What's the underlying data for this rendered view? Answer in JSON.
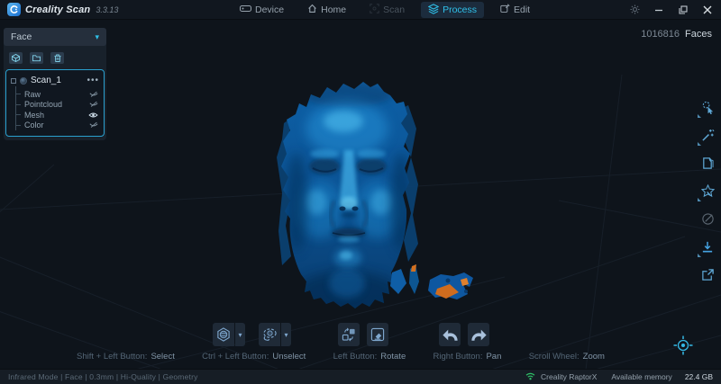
{
  "app": {
    "name": "Creality Scan",
    "version": "3.3.13"
  },
  "titlebar": {
    "tabs": [
      {
        "label": "Device",
        "state": "normal"
      },
      {
        "label": "Home",
        "state": "normal"
      },
      {
        "label": "Scan",
        "state": "disabled"
      },
      {
        "label": "Process",
        "state": "active"
      },
      {
        "label": "Edit",
        "state": "normal"
      }
    ],
    "window_controls": [
      "settings",
      "minimize",
      "maximize",
      "close"
    ]
  },
  "viewport": {
    "faces_count": "1016816",
    "faces_label": "Faces",
    "model": "blue 3D scanned human face mesh with orange debris fragments"
  },
  "left_panel": {
    "group_selector": "Face",
    "tools": [
      "import-model",
      "open-folder",
      "delete-model"
    ],
    "tree": {
      "root_label": "Scan_1",
      "items": [
        {
          "label": "Raw",
          "visible": false
        },
        {
          "label": "Pointcloud",
          "visible": false
        },
        {
          "label": "Mesh",
          "visible": true
        },
        {
          "label": "Color",
          "visible": false
        }
      ]
    }
  },
  "right_toolbar": [
    {
      "name": "select-edit-tool",
      "disabled": false
    },
    {
      "name": "one-click-optimize",
      "disabled": false
    },
    {
      "name": "meshing",
      "disabled": false
    },
    {
      "name": "mesh-simplify",
      "disabled": false
    },
    {
      "name": "texture-mapping",
      "disabled": true
    },
    {
      "name": "export-model",
      "disabled": false
    },
    {
      "name": "share-model",
      "disabled": false
    }
  ],
  "bottom_toolbar": [
    "surface-select",
    "lasso-select",
    "invert-selection",
    "delete-selected",
    "undo",
    "redo"
  ],
  "help_hints": [
    {
      "keys": "Shift + Left Button:",
      "action": "Select"
    },
    {
      "keys": "Ctrl + Left Button:",
      "action": "Unselect"
    },
    {
      "keys": "Left Button:",
      "action": "Rotate"
    },
    {
      "keys": "Right Button:",
      "action": "Pan"
    },
    {
      "keys": "Scroll Wheel:",
      "action": "Zoom"
    }
  ],
  "status_bar": {
    "scan_settings": "Infrared Mode | Face | 0.3mm | Hi-Quality | Geometry",
    "device_name": "Creality RaptorX",
    "memory_label": "Available memory",
    "memory_value": "22.4 GB"
  },
  "icons": {
    "dropdown_glyph": "▾",
    "more_glyph": "•••"
  },
  "colors": {
    "accent": "#2fc0e8",
    "panel_border": "#2aa0cf",
    "model_blue": "#1273c8",
    "debris_orange": "#d4701f",
    "status_green": "#2fc268",
    "titlebar_bg": "#11171f",
    "viewport_bg": "#0e141b"
  }
}
